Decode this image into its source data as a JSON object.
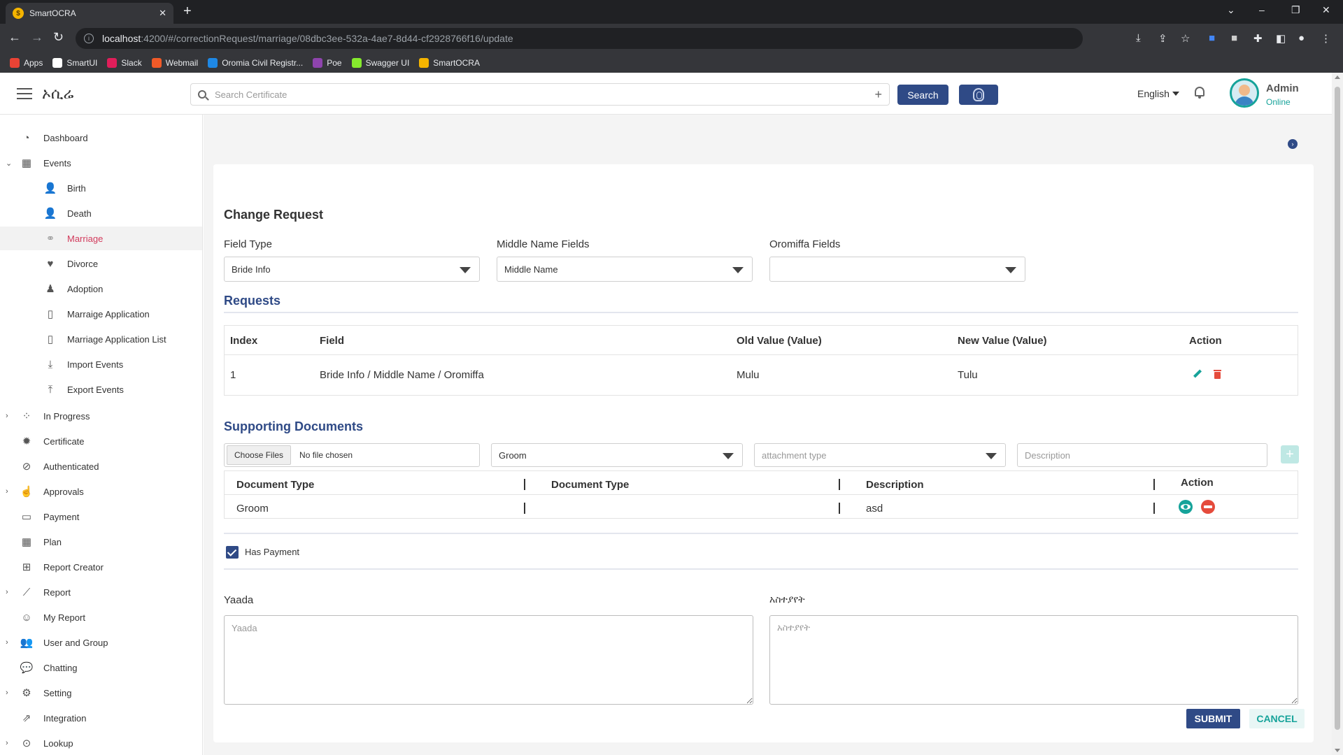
{
  "browser": {
    "tab_title": "SmartOCRA",
    "tab_close": "✕",
    "new_tab": "+",
    "url_host": "localhost",
    "url_path": ":4200/#/correctionRequest/marriage/08dbc3ee-532a-4ae7-8d44-cf2928766f16/update",
    "bookmarks": [
      {
        "label": "Apps",
        "color": "#ea4335"
      },
      {
        "label": "SmartUI",
        "color": "#ffffff"
      },
      {
        "label": "Slack",
        "color": "#e01e5a"
      },
      {
        "label": "Webmail",
        "color": "#f05a28"
      },
      {
        "label": "Oromia Civil Registr...",
        "color": "#1e88e5"
      },
      {
        "label": "Poe",
        "color": "#8e44ad"
      },
      {
        "label": "Swagger UI",
        "color": "#85ea2d"
      },
      {
        "label": "SmartOCRA",
        "color": "#f4b400"
      }
    ]
  },
  "header": {
    "brand": "ኦሲሬ",
    "search_placeholder": "Search Certificate",
    "search_plus": "+",
    "search_button": "Search",
    "language": "English",
    "user_name": "Admin",
    "user_status": "Online"
  },
  "sidebar": {
    "items": [
      {
        "label": "Dashboard",
        "icon": "dashboard-icon",
        "glyph": "◔",
        "chevron": ""
      },
      {
        "label": "Events",
        "icon": "calendar-icon",
        "glyph": "▦",
        "chevron": "⌄"
      },
      {
        "label": "Birth",
        "icon": "birth-icon",
        "glyph": "👤",
        "chevron": ""
      },
      {
        "label": "Death",
        "icon": "death-icon",
        "glyph": "👤",
        "chevron": ""
      },
      {
        "label": "Marriage",
        "icon": "marriage-icon",
        "glyph": "⚭",
        "chevron": ""
      },
      {
        "label": "Divorce",
        "icon": "broken-heart-icon",
        "glyph": "♥",
        "chevron": ""
      },
      {
        "label": "Adoption",
        "icon": "adoption-icon",
        "glyph": "♟",
        "chevron": ""
      },
      {
        "label": "Marraige Application",
        "icon": "document-icon",
        "glyph": "▯",
        "chevron": ""
      },
      {
        "label": "Marriage Application List",
        "icon": "document-icon",
        "glyph": "▯",
        "chevron": ""
      },
      {
        "label": "Import Events",
        "icon": "download-icon",
        "glyph": "⤓",
        "chevron": ""
      },
      {
        "label": "Export Events",
        "icon": "upload-icon",
        "glyph": "⤒",
        "chevron": ""
      },
      {
        "label": "In Progress",
        "icon": "spinner-icon",
        "glyph": "⁘",
        "chevron": "›"
      },
      {
        "label": "Certificate",
        "icon": "certificate-icon",
        "glyph": "✹",
        "chevron": ""
      },
      {
        "label": "Authenticated",
        "icon": "check-circle-icon",
        "glyph": "⊘",
        "chevron": ""
      },
      {
        "label": "Approvals",
        "icon": "thumbs-up-icon",
        "glyph": "☝",
        "chevron": "›"
      },
      {
        "label": "Payment",
        "icon": "credit-card-icon",
        "glyph": "▭",
        "chevron": ""
      },
      {
        "label": "Plan",
        "icon": "calendar-icon",
        "glyph": "▦",
        "chevron": ""
      },
      {
        "label": "Report Creator",
        "icon": "plus-square-icon",
        "glyph": "⊞",
        "chevron": ""
      },
      {
        "label": "Report",
        "icon": "line-chart-icon",
        "glyph": "⟋",
        "chevron": "›"
      },
      {
        "label": "My Report",
        "icon": "smiley-icon",
        "glyph": "☺",
        "chevron": ""
      },
      {
        "label": "User and Group",
        "icon": "users-icon",
        "glyph": "👥",
        "chevron": "›"
      },
      {
        "label": "Chatting",
        "icon": "chat-icon",
        "glyph": "💬",
        "chevron": ""
      },
      {
        "label": "Setting",
        "icon": "gear-icon",
        "glyph": "⚙",
        "chevron": "›"
      },
      {
        "label": "Integration",
        "icon": "external-link-icon",
        "glyph": "⇗",
        "chevron": ""
      },
      {
        "label": "Lookup",
        "icon": "search-icon",
        "glyph": "⊙",
        "chevron": "›"
      }
    ]
  },
  "form": {
    "title": "Change Request",
    "field_type_label": "Field Type",
    "field_type_value": "Bride Info",
    "middle_name_label": "Middle Name Fields",
    "middle_name_value": "Middle Name",
    "oromiffa_label": "Oromiffa Fields",
    "oromiffa_value": ""
  },
  "requests": {
    "title": "Requests",
    "headers": [
      "Index",
      "Field",
      "Old Value (Value)",
      "New Value (Value)",
      "Action"
    ],
    "rows": [
      {
        "index": "1",
        "field": "Bride Info / Middle Name / Oromiffa",
        "old": "Mulu",
        "new": "Tulu"
      }
    ]
  },
  "documents": {
    "title": "Supporting Documents",
    "choose_files": "Choose Files",
    "no_file": "No file chosen",
    "owner_value": "Groom",
    "attachment_placeholder": "attachment type",
    "description_placeholder": "Description",
    "add": "+",
    "headers": [
      "Document Type",
      "Document Type",
      "Description",
      "Action"
    ],
    "separator": "|",
    "rows": [
      {
        "type": "Groom",
        "doc_type": "",
        "description": "asd"
      }
    ]
  },
  "payment": {
    "has_payment_label": "Has Payment",
    "checked": true
  },
  "remarks": {
    "yaada_label": "Yaada",
    "yaada_placeholder": "Yaada",
    "amharic_label": "አስተያየት",
    "amharic_placeholder": "አስተያየት"
  },
  "actions": {
    "submit": "SUBMIT",
    "cancel": "CANCEL"
  },
  "colors": {
    "primary": "#2f4a86",
    "teal": "#16a39a",
    "danger": "#e54b3c",
    "active_nav": "#d23b5c"
  }
}
